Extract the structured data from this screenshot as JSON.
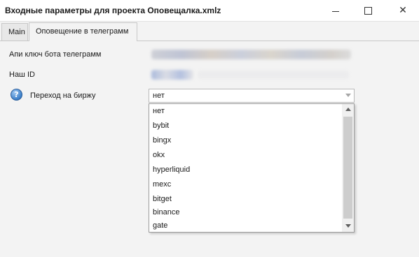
{
  "window": {
    "title": "Входные параметры для проекта Оповещалка.xmlz",
    "buttons": {
      "minimize": "minimize-icon",
      "maximize": "maximize-icon",
      "close": "close-icon"
    },
    "close_glyph": "✕"
  },
  "tabs": [
    {
      "label": "Main",
      "active": false
    },
    {
      "label": "Оповещение в телеграмм",
      "active": true
    }
  ],
  "fields": {
    "bot_key": {
      "label": "Апи ключ бота телеграмм"
    },
    "our_id": {
      "label": "Наш ID"
    },
    "exchange": {
      "label": "Переход на биржу",
      "value": "нет",
      "help_icon": "help-question-icon",
      "help_glyph": "?"
    }
  },
  "dropdown": {
    "options": [
      "нет",
      "bybit",
      "bingx",
      "okx",
      "hyperliquid",
      "mexc",
      "bitget",
      "binance",
      "gate"
    ]
  },
  "colors": {
    "window_bg": "#f3f3f3",
    "titlebar_bg": "#ffffff",
    "help_icon_blue": "#3c7fc8"
  }
}
